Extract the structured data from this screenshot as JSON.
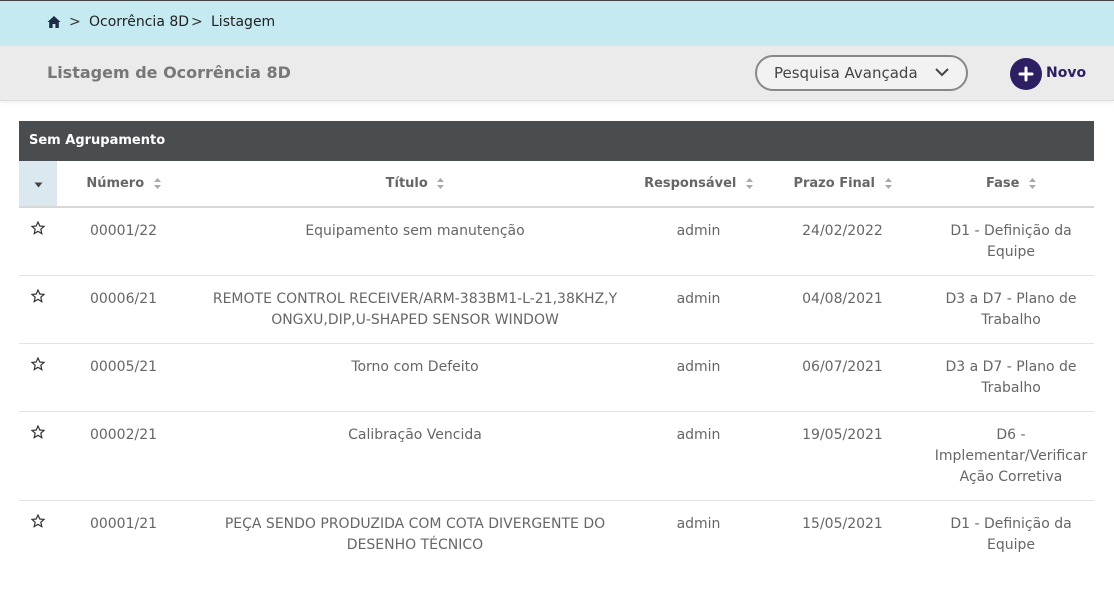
{
  "breadcrumb": {
    "items": [
      "Ocorrência 8D",
      "Listagem"
    ],
    "separator": ">"
  },
  "header": {
    "title": "Listagem de Ocorrência 8D",
    "search_label": "Pesquisa Avançada",
    "new_label": "Novo"
  },
  "group": {
    "label": "Sem Agrupamento"
  },
  "table": {
    "columns": [
      "Número",
      "Título",
      "Responsável",
      "Prazo Final",
      "Fase"
    ],
    "rows": [
      {
        "numero": "00001/22",
        "titulo": "Equipamento sem manutenção",
        "responsavel": "admin",
        "prazo": "24/02/2022",
        "fase": "D1 - Definição da Equipe"
      },
      {
        "numero": "00006/21",
        "titulo": "REMOTE CONTROL RECEIVER/ARM-383BM1-L-21,38KHZ,YONGXU,DIP,U-SHAPED SENSOR WINDOW",
        "responsavel": "admin",
        "prazo": "04/08/2021",
        "fase": "D3 a D7 - Plano de Trabalho"
      },
      {
        "numero": "00005/21",
        "titulo": "Torno com Defeito",
        "responsavel": "admin",
        "prazo": "06/07/2021",
        "fase": "D3 a D7 - Plano de Trabalho"
      },
      {
        "numero": "00002/21",
        "titulo": "Calibração Vencida",
        "responsavel": "admin",
        "prazo": "19/05/2021",
        "fase": "D6 - Implementar/Verificar Ação Corretiva"
      },
      {
        "numero": "00001/21",
        "titulo": "PEÇA SENDO PRODUZIDA COM COTA DIVERGENTE DO DESENHO TÉCNICO",
        "responsavel": "admin",
        "prazo": "15/05/2021",
        "fase": "D1 - Definição da Equipe"
      }
    ]
  },
  "colors": {
    "breadcrumb_bg": "#c5eaf2",
    "accent": "#2e1f63",
    "group_bar": "#4a4d50"
  },
  "icons": [
    "home-icon",
    "chevron-down-icon",
    "plus-icon",
    "sort-icon",
    "star-icon"
  ]
}
